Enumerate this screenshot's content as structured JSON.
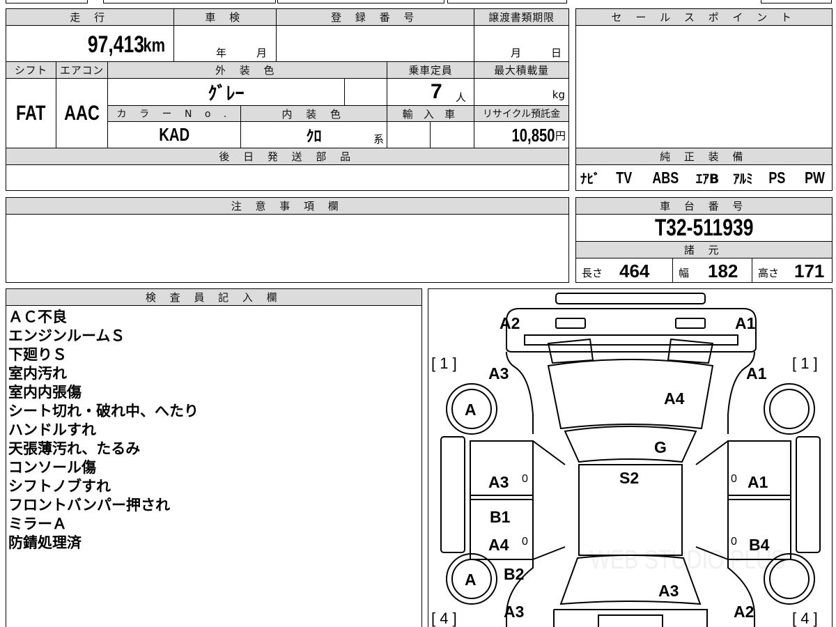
{
  "top_left": {
    "mileage": {
      "label": "走 行",
      "value": "97,413",
      "unit": "km"
    },
    "inspection": {
      "label": "車 検",
      "year_label": "年",
      "month_label": "月"
    },
    "registration": {
      "label": "登 録 番 号"
    },
    "transfer_deadline": {
      "label": "譲渡書類期限",
      "month_label": "月",
      "day_label": "日"
    },
    "shift": {
      "label": "シフト",
      "value": "FAT"
    },
    "aircon": {
      "label": "エアコン",
      "value": "AAC"
    },
    "exterior_color": {
      "label": "外 装 色",
      "value": "ｸﾞﾚｰ"
    },
    "capacity": {
      "label": "乗車定員",
      "value": "7",
      "unit": "人"
    },
    "max_load": {
      "label": "最大積載量",
      "unit": "kg"
    },
    "color_no": {
      "label": "カ ラ ー N o .",
      "value": "KAD"
    },
    "interior_color": {
      "label": "内 装 色",
      "value": "ｸﾛ",
      "suffix": "系"
    },
    "import": {
      "label": "輸 入 車"
    },
    "recycle_fee": {
      "label": "リサイクル預託金",
      "value": "10,850",
      "unit": "円"
    },
    "later_parts": {
      "label": "後 日 発 送 部 品"
    }
  },
  "sales_point": {
    "label": "セ ー ル ス ポ イ ン ト"
  },
  "genuine_equipment": {
    "label": "純 正 装 備",
    "items": [
      "ﾅﾋﾞ",
      "TV",
      "ABS",
      "ｴｱB",
      "ｱﾙﾐ",
      "PS",
      "PW"
    ]
  },
  "caution": {
    "label": "注 意 事 項 欄"
  },
  "chassis": {
    "label": "車 台 番 号",
    "value": "T32-511939"
  },
  "specs": {
    "label": "諸 元",
    "length_label": "長さ",
    "length": "464",
    "width_label": "幅",
    "width": "182",
    "height_label": "高さ",
    "height": "171"
  },
  "inspector": {
    "label": "検 査 員 記 入 欄",
    "lines": [
      "ＡＣ不良",
      "エンジンルームＳ",
      "下廻りＳ",
      "室内汚れ",
      "室内内張傷",
      "シート切れ・破れ中、へたり",
      "ハンドルすれ",
      "天張薄汚れ、たるみ",
      "コンソール傷",
      "シフトノブすれ",
      "フロントバンパー押され",
      "ミラーＡ",
      "防錆処理済"
    ]
  },
  "diagram": {
    "labels": {
      "front_left": "A2",
      "front_right": "A1",
      "fender_left": "A3",
      "fender_right": "A1",
      "hood": "A4",
      "windshield": "G",
      "roof": "S2",
      "tire_front_left": "A",
      "tire_rear_left": "A",
      "front_door_left": "A3",
      "front_door_right": "A1",
      "rear_door_left_top": "B1",
      "rear_door_left": "A4",
      "rear_door_right": "B4",
      "rear_quarter_left": "B2",
      "rear_quarter_left_low": "A3",
      "tailgate": "A3",
      "rear_corner_right": "A2",
      "zero_mark": "0",
      "bracket_front_left": "[ 1 ]",
      "bracket_front_right": "[ 1 ]",
      "bracket_rear_left": "[ 4 ]",
      "bracket_rear_right": "[ 4 ]"
    },
    "watermark": "WEB STUDIO PLUS"
  }
}
